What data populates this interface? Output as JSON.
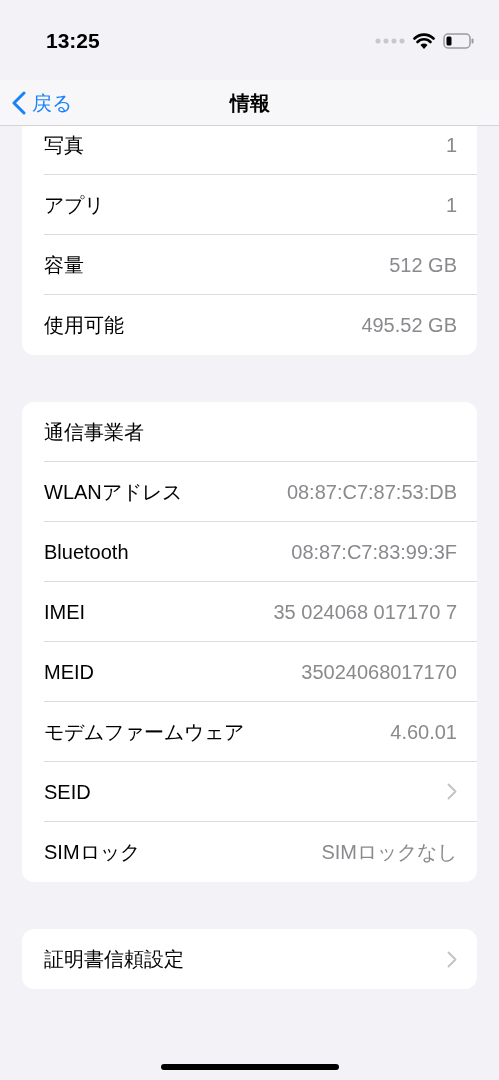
{
  "status_bar": {
    "time": "13:25"
  },
  "nav": {
    "back": "戻る",
    "title": "情報"
  },
  "sections": [
    {
      "rows": [
        {
          "kind": "value",
          "label": "写真",
          "value": "1"
        },
        {
          "kind": "value",
          "label": "アプリ",
          "value": "1"
        },
        {
          "kind": "value",
          "label": "容量",
          "value": "512 GB"
        },
        {
          "kind": "value",
          "label": "使用可能",
          "value": "495.52 GB"
        }
      ]
    },
    {
      "rows": [
        {
          "kind": "plain",
          "label": "通信事業者"
        },
        {
          "kind": "value",
          "label": "WLANアドレス",
          "value": "08:87:C7:87:53:DB"
        },
        {
          "kind": "value",
          "label": "Bluetooth",
          "value": "08:87:C7:83:99:3F"
        },
        {
          "kind": "value",
          "label": "IMEI",
          "value": "35 024068 017170 7"
        },
        {
          "kind": "value",
          "label": "MEID",
          "value": "35024068017170"
        },
        {
          "kind": "value",
          "label": "モデムファームウェア",
          "value": "4.60.01"
        },
        {
          "kind": "link",
          "label": "SEID"
        },
        {
          "kind": "value",
          "label": "SIMロック",
          "value": "SIMロックなし"
        }
      ]
    },
    {
      "rows": [
        {
          "kind": "link",
          "label": "証明書信頼設定"
        }
      ]
    }
  ]
}
